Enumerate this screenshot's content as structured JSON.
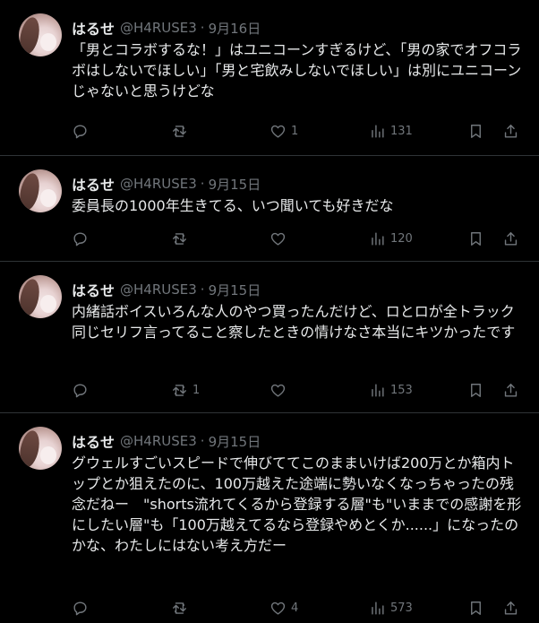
{
  "tweets": [
    {
      "name": "はるせ",
      "handle": "@H4RUSE3",
      "sep": "·",
      "date": "9月16日",
      "text": "「男とコラボするな！」はユニコーンすぎるけど、「男の家でオフコラボはしないでほしい」「男と宅飲みしないでほしい」は別にユニコーンじゃないと思うけどな",
      "replies": "",
      "retweets": "",
      "likes": "1",
      "views": "131"
    },
    {
      "name": "はるせ",
      "handle": "@H4RUSE3",
      "sep": "·",
      "date": "9月15日",
      "text": "委員長の1000年生きてる、いつ聞いても好きだな",
      "replies": "",
      "retweets": "",
      "likes": "",
      "views": "120"
    },
    {
      "name": "はるせ",
      "handle": "@H4RUSE3",
      "sep": "·",
      "date": "9月15日",
      "text": "内緒話ボイスいろんな人のやつ買ったんだけど、ロとロが全トラック同じセリフ言ってること察したときの情けなさ本当にキツかったです",
      "replies": "",
      "retweets": "1",
      "likes": "",
      "views": "153"
    },
    {
      "name": "はるせ",
      "handle": "@H4RUSE3",
      "sep": "·",
      "date": "9月15日",
      "text": "グウェルすごいスピードで伸びててこのままいけば200万とか箱内トップとか狙えたのに、100万越えた途端に勢いなくなっちゃったの残念だねー　\"shorts流れてくるから登録する層\"も\"いままでの感謝を形にしたい層\"も「100万越えてるなら登録やめとくか......」になったのかな、わたしにはない考え方だー",
      "replies": "",
      "retweets": "",
      "likes": "4",
      "views": "573"
    }
  ],
  "icons": {
    "reply": "reply-icon",
    "retweet": "retweet-icon",
    "like": "heart-icon",
    "views": "views-icon",
    "bookmark": "bookmark-icon",
    "share": "share-icon"
  },
  "colors": {
    "background": "#000000",
    "text": "#e7e9ea",
    "muted": "#71767b",
    "divider": "#2f3336"
  }
}
